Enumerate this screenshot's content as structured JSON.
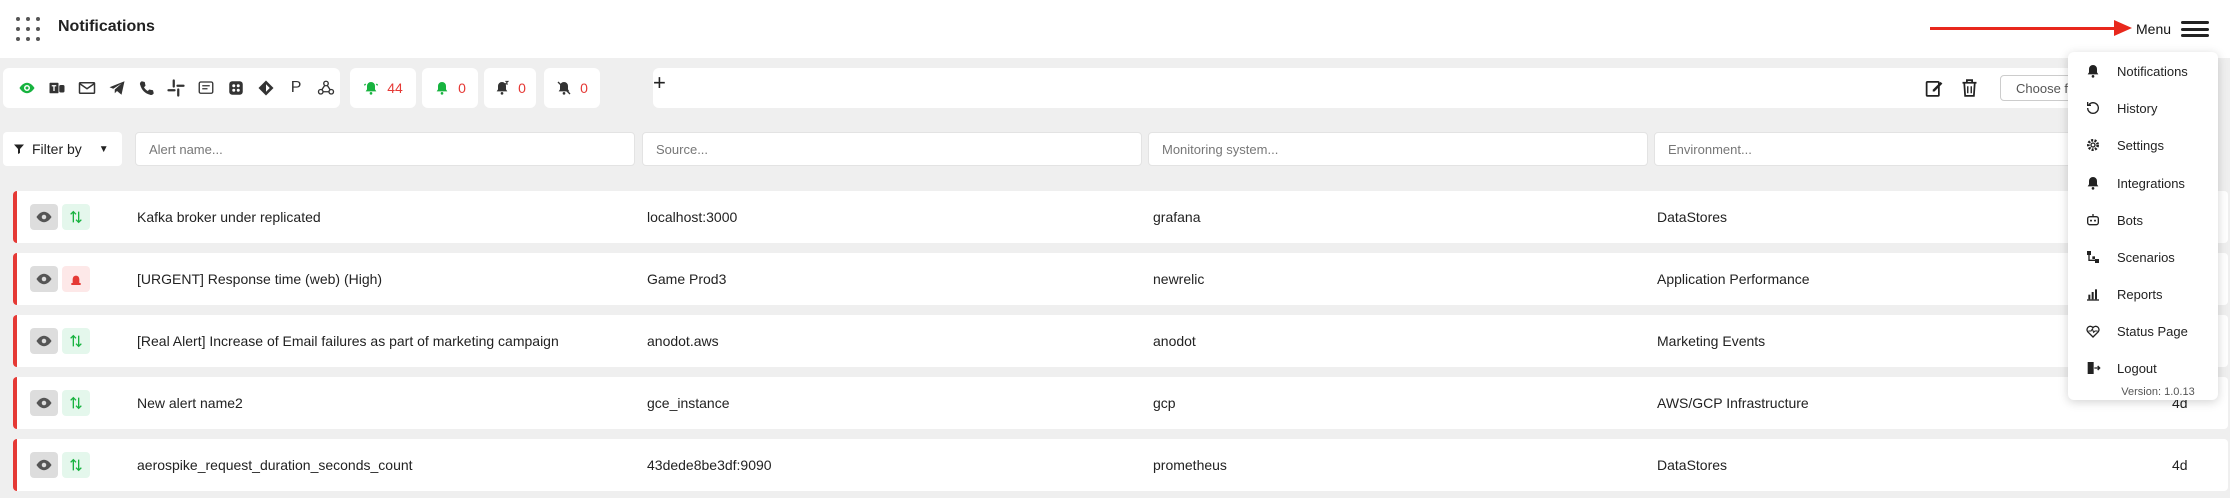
{
  "header": {
    "title": "Notifications",
    "menu_label": "Menu"
  },
  "channels": [
    "eye-icon",
    "teams-icon",
    "email-icon",
    "telegram-icon",
    "phone-icon",
    "slack-icon",
    "sms-icon",
    "custom-icon",
    "diamond-icon",
    "P",
    "webhook-icon"
  ],
  "counters": [
    {
      "icon": "alert-bell-icon",
      "value": "44",
      "color": "#17b33f"
    },
    {
      "icon": "ack-bell-icon",
      "value": "0",
      "color": "#17b33f"
    },
    {
      "icon": "snooze-bell-icon",
      "value": "0",
      "color": "#333333"
    },
    {
      "icon": "muted-bell-icon",
      "value": "0",
      "color": "#333333"
    }
  ],
  "toolbar": {
    "add_label": "+",
    "choose_placeholder": "Choose f"
  },
  "filters": {
    "filter_by_label": "Filter by",
    "alert_name_placeholder": "Alert name...",
    "source_placeholder": "Source...",
    "monitoring_placeholder": "Monitoring system...",
    "environment_placeholder": "Environment..."
  },
  "alerts": [
    {
      "name": "Kafka broker under replicated",
      "source": "localhost:3000",
      "monitoring": "grafana",
      "environment": "DataStores",
      "age": "",
      "status": "up-down"
    },
    {
      "name": "[URGENT] Response time (web) (High)",
      "source": "Game Prod3",
      "monitoring": "newrelic",
      "environment": "Application Performance",
      "age": "",
      "status": "siren"
    },
    {
      "name": "[Real Alert] Increase of Email failures as part of marketing campaign",
      "source": "anodot.aws",
      "monitoring": "anodot",
      "environment": "Marketing Events",
      "age": "",
      "status": "up-down"
    },
    {
      "name": "New alert name2",
      "source": "gce_instance",
      "monitoring": "gcp",
      "environment": "AWS/GCP Infrastructure",
      "age": "4d",
      "status": "up-down"
    },
    {
      "name": "aerospike_request_duration_seconds_count",
      "source": "43dede8be3df:9090",
      "monitoring": "prometheus",
      "environment": "DataStores",
      "age": "4d",
      "status": "up-down"
    }
  ],
  "menu": {
    "items": [
      {
        "label": "Notifications",
        "icon": "bell-icon"
      },
      {
        "label": "History",
        "icon": "history-icon"
      },
      {
        "label": "Settings",
        "icon": "gear-icon"
      },
      {
        "label": "Integrations",
        "icon": "bell-icon"
      },
      {
        "label": "Bots",
        "icon": "bot-icon"
      },
      {
        "label": "Scenarios",
        "icon": "scenarios-icon"
      },
      {
        "label": "Reports",
        "icon": "reports-icon"
      },
      {
        "label": "Status Page",
        "icon": "heartbeat-icon"
      },
      {
        "label": "Logout",
        "icon": "logout-icon"
      }
    ],
    "version": "Version: 1.0.13"
  },
  "colors": {
    "alert_border": "#e53935",
    "accent_green": "#17b33f",
    "annotation_arrow": "#e8281c"
  }
}
